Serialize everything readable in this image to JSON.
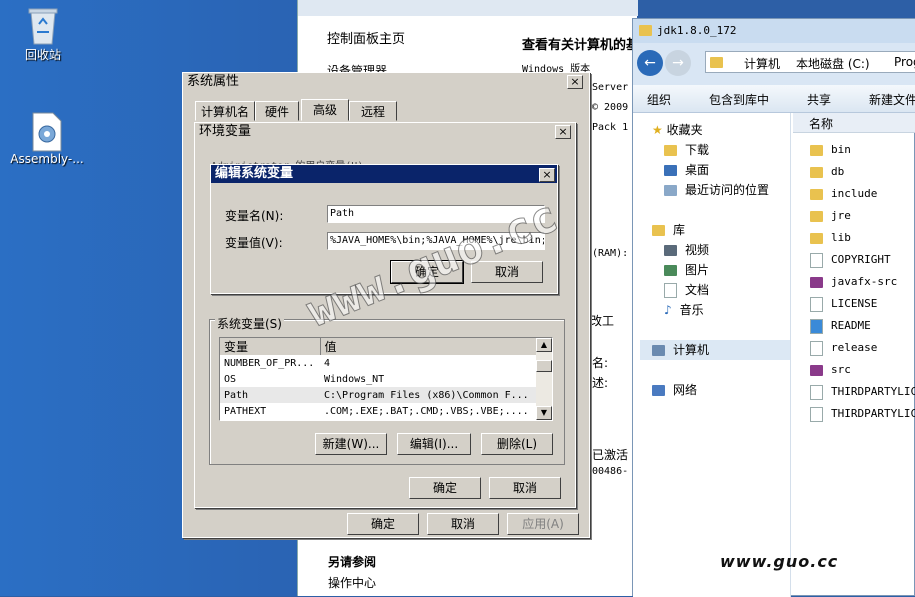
{
  "desktop": {
    "icons": [
      {
        "label": "回收站",
        "icon": "recycle-bin-icon"
      },
      {
        "label": "Assembly-...",
        "icon": "assembly-file-icon"
      }
    ]
  },
  "control_panel": {
    "home_link": "控制面板主页",
    "device_manager": "设备管理器",
    "heading": "查看有关计算机的基",
    "windows_edition": "Windows 版本",
    "server": "Server",
    "copyright": "© 2009",
    "pack": "Pack 1",
    "ram": "(RAM):",
    "name": "名:",
    "desc": "述:",
    "activated": "已激活",
    "product_id": "00486-",
    "see_also": "另请参阅",
    "action_center": "操作中心",
    "change": "改工"
  },
  "explorer": {
    "title": "jdk1.8.0_172",
    "breadcrumb": [
      "计算机",
      "本地磁盘 (C:)",
      "Prog"
    ],
    "commands": [
      "组织",
      "包含到库中",
      "共享",
      "新建文件"
    ],
    "column_name": "名称",
    "nav": {
      "favorites": "收藏夹",
      "downloads": "下载",
      "desktop": "桌面",
      "recent": "最近访问的位置",
      "libraries": "库",
      "videos": "视频",
      "pictures": "图片",
      "documents": "文档",
      "music": "音乐",
      "computer": "计算机",
      "network": "网络"
    },
    "files": [
      {
        "name": "bin",
        "type": "folder"
      },
      {
        "name": "db",
        "type": "folder"
      },
      {
        "name": "include",
        "type": "folder"
      },
      {
        "name": "jre",
        "type": "folder"
      },
      {
        "name": "lib",
        "type": "folder"
      },
      {
        "name": "COPYRIGHT",
        "type": "file"
      },
      {
        "name": "javafx-src",
        "type": "archive"
      },
      {
        "name": "LICENSE",
        "type": "file"
      },
      {
        "name": "README",
        "type": "html"
      },
      {
        "name": "release",
        "type": "file"
      },
      {
        "name": "src",
        "type": "archive"
      },
      {
        "name": "THIRDPARTYLICE",
        "type": "file"
      },
      {
        "name": "THIRDPARTYLICE",
        "type": "file"
      }
    ]
  },
  "system_properties": {
    "title": "系统属性",
    "tabs": [
      "计算机名",
      "硬件",
      "高级",
      "远程"
    ],
    "ok": "确定",
    "cancel": "取消",
    "apply": "应用(A)"
  },
  "env_vars": {
    "title": "环境变量",
    "user_group_hint": "Administrator 的用户变量(U)",
    "system_group": "系统变量(S)",
    "col_variable": "变量",
    "col_value": "值",
    "rows": [
      {
        "name": "NUMBER_OF_PR...",
        "value": "4"
      },
      {
        "name": "OS",
        "value": "Windows_NT"
      },
      {
        "name": "Path",
        "value": "C:\\Program Files (x86)\\Common F..."
      },
      {
        "name": "PATHEXT",
        "value": ".COM;.EXE;.BAT;.CMD;.VBS;.VBE;...."
      }
    ],
    "new": "新建(W)...",
    "edit": "编辑(I)...",
    "delete": "删除(L)",
    "ok": "确定",
    "cancel": "取消"
  },
  "edit_var": {
    "title": "编辑系统变量",
    "name_label": "变量名(N):",
    "name_value": "Path",
    "value_label": "变量值(V):",
    "value_value": "%JAVA_HOME%\\bin;%JAVA_HOME%\\jre\\bin;",
    "ok": "确定",
    "cancel": "取消",
    "close": "×"
  },
  "watermark": {
    "large": "www.guo.cc",
    "bottom": "www.guo.cc"
  },
  "colors": {
    "desktop_blue": "#2b6fc4",
    "title_active": "#0a246a",
    "dialog_gray": "#d4d0c8"
  }
}
